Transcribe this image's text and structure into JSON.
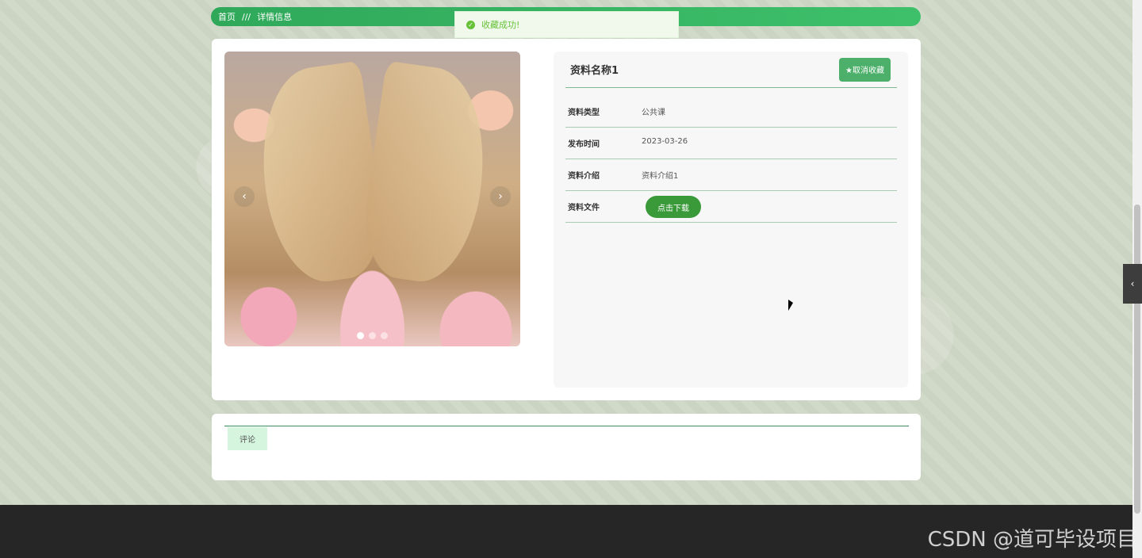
{
  "breadcrumb": {
    "home": "首页",
    "separator": "///",
    "current": "详情信息"
  },
  "toast": {
    "message": "收藏成功!",
    "icon": "check-circle-icon",
    "color": "#67c23a"
  },
  "carousel": {
    "prev": "‹",
    "next": "›",
    "slide_count": 3,
    "active_index": 0
  },
  "detail": {
    "title": "资料名称1",
    "favorite_button": "★取消收藏",
    "rows": [
      {
        "label": "资料类型",
        "value": "公共课"
      },
      {
        "label": "发布时间",
        "value": "2023-03-26"
      },
      {
        "label": "资料介绍",
        "value": "资料介绍1"
      },
      {
        "label": "资料文件",
        "button": "点击下载"
      }
    ]
  },
  "comments": {
    "tab_label": "评论"
  },
  "watermark": "CSDN @道可毕设项目",
  "side_tab": {
    "icon": "chevron-left-icon",
    "glyph": "‹"
  },
  "colors": {
    "accent": "#3ec06a",
    "button_green": "#4caf6a",
    "download_green": "#3a9a3a",
    "footer": "#262626"
  }
}
